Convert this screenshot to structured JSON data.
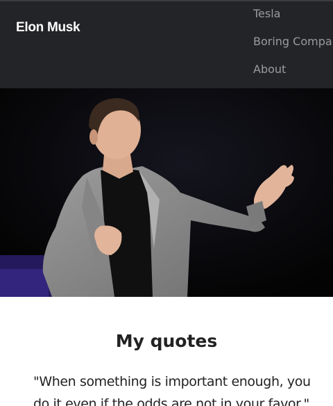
{
  "navbar": {
    "brand": "Elon Musk",
    "links": [
      "Tesla",
      "Boring Company",
      "About"
    ]
  },
  "hero": {
    "image_alt": "Elon Musk speaking on stage"
  },
  "quotes": {
    "title": "My quotes",
    "items": [
      "\"When something is important enough, you do it even if the odds are not in your favor.\""
    ]
  },
  "colors": {
    "navbar_bg": "#232427",
    "nav_link": "#9a9b9e",
    "brand": "#ffffff",
    "hero_bg": "#050505"
  }
}
